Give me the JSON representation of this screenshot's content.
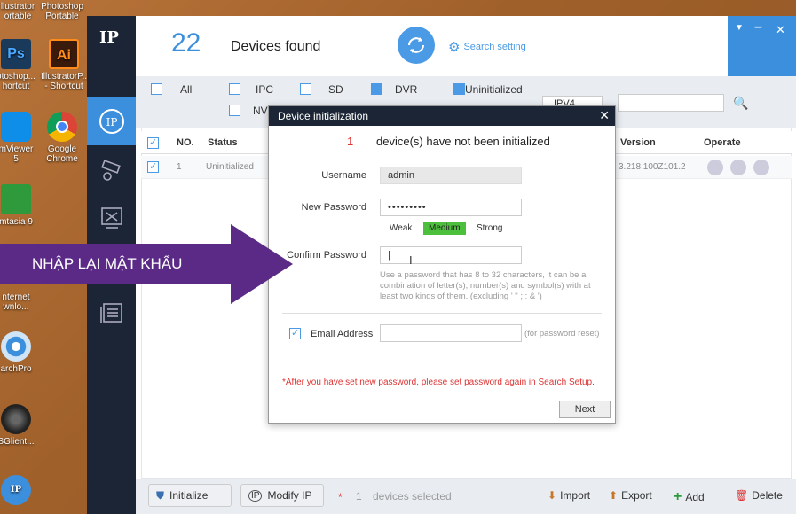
{
  "desktop_icons": [
    {
      "label": "llustrator\nortable"
    },
    {
      "label": "Photoshop\nPortable"
    },
    {
      "label": "otoshop...\nhortcut"
    },
    {
      "label": "IllustratorP...\n- Shortcut"
    },
    {
      "label": "mViewer\n5"
    },
    {
      "label": "Google\nChrome"
    },
    {
      "label": "mtasia 9"
    },
    {
      "label": "nternet\nwnlo..."
    },
    {
      "label": "archPro"
    },
    {
      "label": "SGlient..."
    }
  ],
  "header": {
    "count": "22",
    "found_label": "Devices found",
    "search_setting": "Search setting"
  },
  "filters": {
    "all": "All",
    "ipc": "IPC",
    "sd": "SD",
    "dvr": "DVR",
    "uninitialized": "Uninitialized",
    "nvr": "NVI",
    "ip_type": "IPV4"
  },
  "table": {
    "headers": {
      "no": "NO.",
      "status": "Status",
      "version": "Version",
      "operate": "Operate"
    },
    "rows": [
      {
        "no": "1",
        "status": "Uninitialized",
        "version": "3.218.100Z101.2"
      }
    ]
  },
  "dialog": {
    "title": "Device initialization",
    "count": "1",
    "message": "device(s) have not been initialized",
    "username_label": "Username",
    "username_value": "admin",
    "newpw_label": "New Password",
    "newpw_value": "•••••••••",
    "strength": {
      "weak": "Weak",
      "medium": "Medium",
      "strong": "Strong"
    },
    "confirm_label": "Confirm Password",
    "confirm_value": "|",
    "hint": "Use a password that has 8 to 32 characters, it can be a combination of letter(s), number(s) and symbol(s) with at least two kinds of them. (excluding ' \" ; : & ')",
    "email_label": "Email Address",
    "email_hint": "(for password reset)",
    "warning": "*After you have set new password, please set password again in Search Setup.",
    "next": "Next"
  },
  "bottom": {
    "initialize": "Initialize",
    "modify_ip": "Modify IP",
    "selected_count": "1",
    "selected_label": "devices selected",
    "import": "Import",
    "export": "Export",
    "add": "Add",
    "delete": "Delete"
  },
  "annotation": {
    "text": "NHẬP LẠI MẬT KHẨU"
  }
}
